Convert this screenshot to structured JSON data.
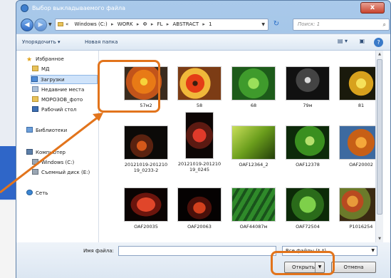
{
  "window": {
    "title": "Выбор выкладываемого файла",
    "close_label": "x"
  },
  "address": {
    "crumbs": [
      "«",
      "Windows (C:)",
      "WORK",
      "Ф",
      "FL",
      "ABSTRACT",
      "1"
    ],
    "search_placeholder": "Поиск: 1"
  },
  "toolbar": {
    "organize_label": "Упорядочить ▾",
    "new_folder_label": "Новая папка"
  },
  "sidebar": {
    "items": [
      {
        "label": "Избранное",
        "icon": "star-icon"
      },
      {
        "label": "МД",
        "icon": "folder-icon"
      },
      {
        "label": "Загрузки",
        "icon": "downloads-icon",
        "selected": true
      },
      {
        "label": "Недавние места",
        "icon": "recent-places-icon"
      },
      {
        "label": "МОРОЗОВ_фото",
        "icon": "folder-icon"
      },
      {
        "label": "Рабочий стол",
        "icon": "desktop-icon"
      },
      {
        "label": "Библиотеки",
        "icon": "libraries-icon"
      },
      {
        "label": "Компьютер",
        "icon": "computer-icon"
      },
      {
        "label": "Windows (C:)",
        "icon": "drive-icon"
      },
      {
        "label": "Съемный диск (E:)",
        "icon": "drive-icon"
      },
      {
        "label": "Сеть",
        "icon": "network-icon"
      }
    ]
  },
  "files": [
    {
      "name": "57м2",
      "thumb": "orange flower"
    },
    {
      "name": "58",
      "thumb": "red-yellow flowers"
    },
    {
      "name": "68",
      "thumb": "green leaves"
    },
    {
      "name": "79м",
      "thumb": "dark foliage"
    },
    {
      "name": "81",
      "thumb": "yellow flowers"
    },
    {
      "name": "20121019-201210\n19_0233-2",
      "thumb": "autumn leaves"
    },
    {
      "name": "20121019-201210\n19_0245",
      "thumb": "red leaves"
    },
    {
      "name": "OAF12364_2",
      "thumb": "green leaf"
    },
    {
      "name": "OAF12378",
      "thumb": "green leaf close-up"
    },
    {
      "name": "OAF20002",
      "thumb": "orange leaves"
    },
    {
      "name": "OAF20035",
      "thumb": "red leaf"
    },
    {
      "name": "OAF20063",
      "thumb": "red leaf dark"
    },
    {
      "name": "OAF44087м",
      "thumb": "grass"
    },
    {
      "name": "OAF72504",
      "thumb": "water drops"
    },
    {
      "name": "P1016254",
      "thumb": "fruit"
    }
  ],
  "bottom": {
    "filename_label": "Имя файла:",
    "filename_value": "",
    "filetype_value": "Все файлы (*.*)",
    "open_label": "Открыть",
    "cancel_label": "Отмена"
  },
  "highlight_color": "#e2741c"
}
